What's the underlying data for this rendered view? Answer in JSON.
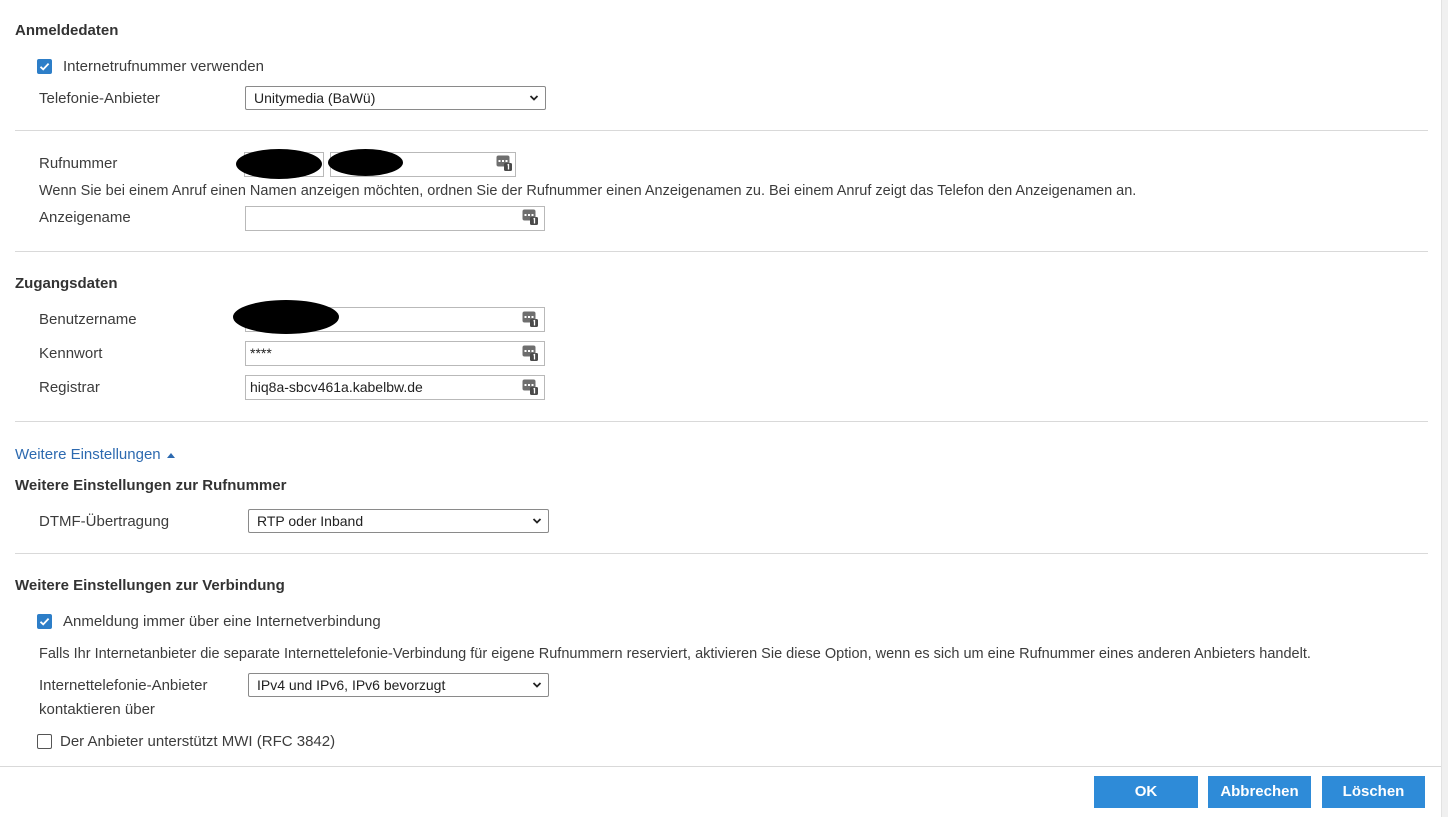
{
  "login": {
    "heading": "Anmeldedaten",
    "use_internet_number_label": "Internetrufnummer verwenden",
    "use_internet_number_checked": true,
    "provider_label": "Telefonie-Anbieter",
    "provider_value": "Unitymedia (BaWü)"
  },
  "number": {
    "rufnummer_label": "Rufnummer",
    "hint": "Wenn Sie bei einem Anruf einen Namen anzeigen möchten, ordnen Sie der Rufnummer einen Anzeigenamen zu. Bei einem Anruf zeigt das Telefon den Anzeigenamen an.",
    "display_name_label": "Anzeigename",
    "display_name_value": ""
  },
  "access": {
    "heading": "Zugangsdaten",
    "username_label": "Benutzername",
    "password_label": "Kennwort",
    "password_value": "****",
    "registrar_label": "Registrar",
    "registrar_value": "hiq8a-sbcv461a.kabelbw.de"
  },
  "more": {
    "toggle_label": "Weitere Einstellungen",
    "number_heading": "Weitere Einstellungen zur Rufnummer",
    "dtmf_label": "DTMF-Übertragung",
    "dtmf_value": "RTP oder Inband",
    "connection_heading": "Weitere Einstellungen zur Verbindung",
    "always_internet_label": "Anmeldung immer über eine Internetverbindung",
    "always_internet_checked": true,
    "always_internet_hint": "Falls Ihr Internetanbieter die separate Internettelefonie-Verbindung für eigene Rufnummern reserviert, aktivieren Sie diese Option, wenn es sich um eine Rufnummer eines anderen Anbieters handelt.",
    "contact_label_line1": "Internettelefonie-Anbieter",
    "contact_label_line2": "kontaktieren über",
    "contact_value": "IPv4 und IPv6, IPv6 bevorzugt",
    "mwi_label": "Der Anbieter unterstützt MWI (RFC 3842)",
    "mwi_checked": false
  },
  "buttons": {
    "ok": "OK",
    "cancel": "Abbrechen",
    "delete": "Löschen"
  },
  "colors": {
    "accent": "#2e8bd8",
    "checkbox": "#2d7ec8",
    "link": "#2d6ab0"
  },
  "icons": {
    "checkbox_checked": "checkmark-icon",
    "select_arrow": "chevron-down-icon",
    "field_helper": "keypad-icon",
    "toggle_arrow": "triangle-up-icon"
  }
}
